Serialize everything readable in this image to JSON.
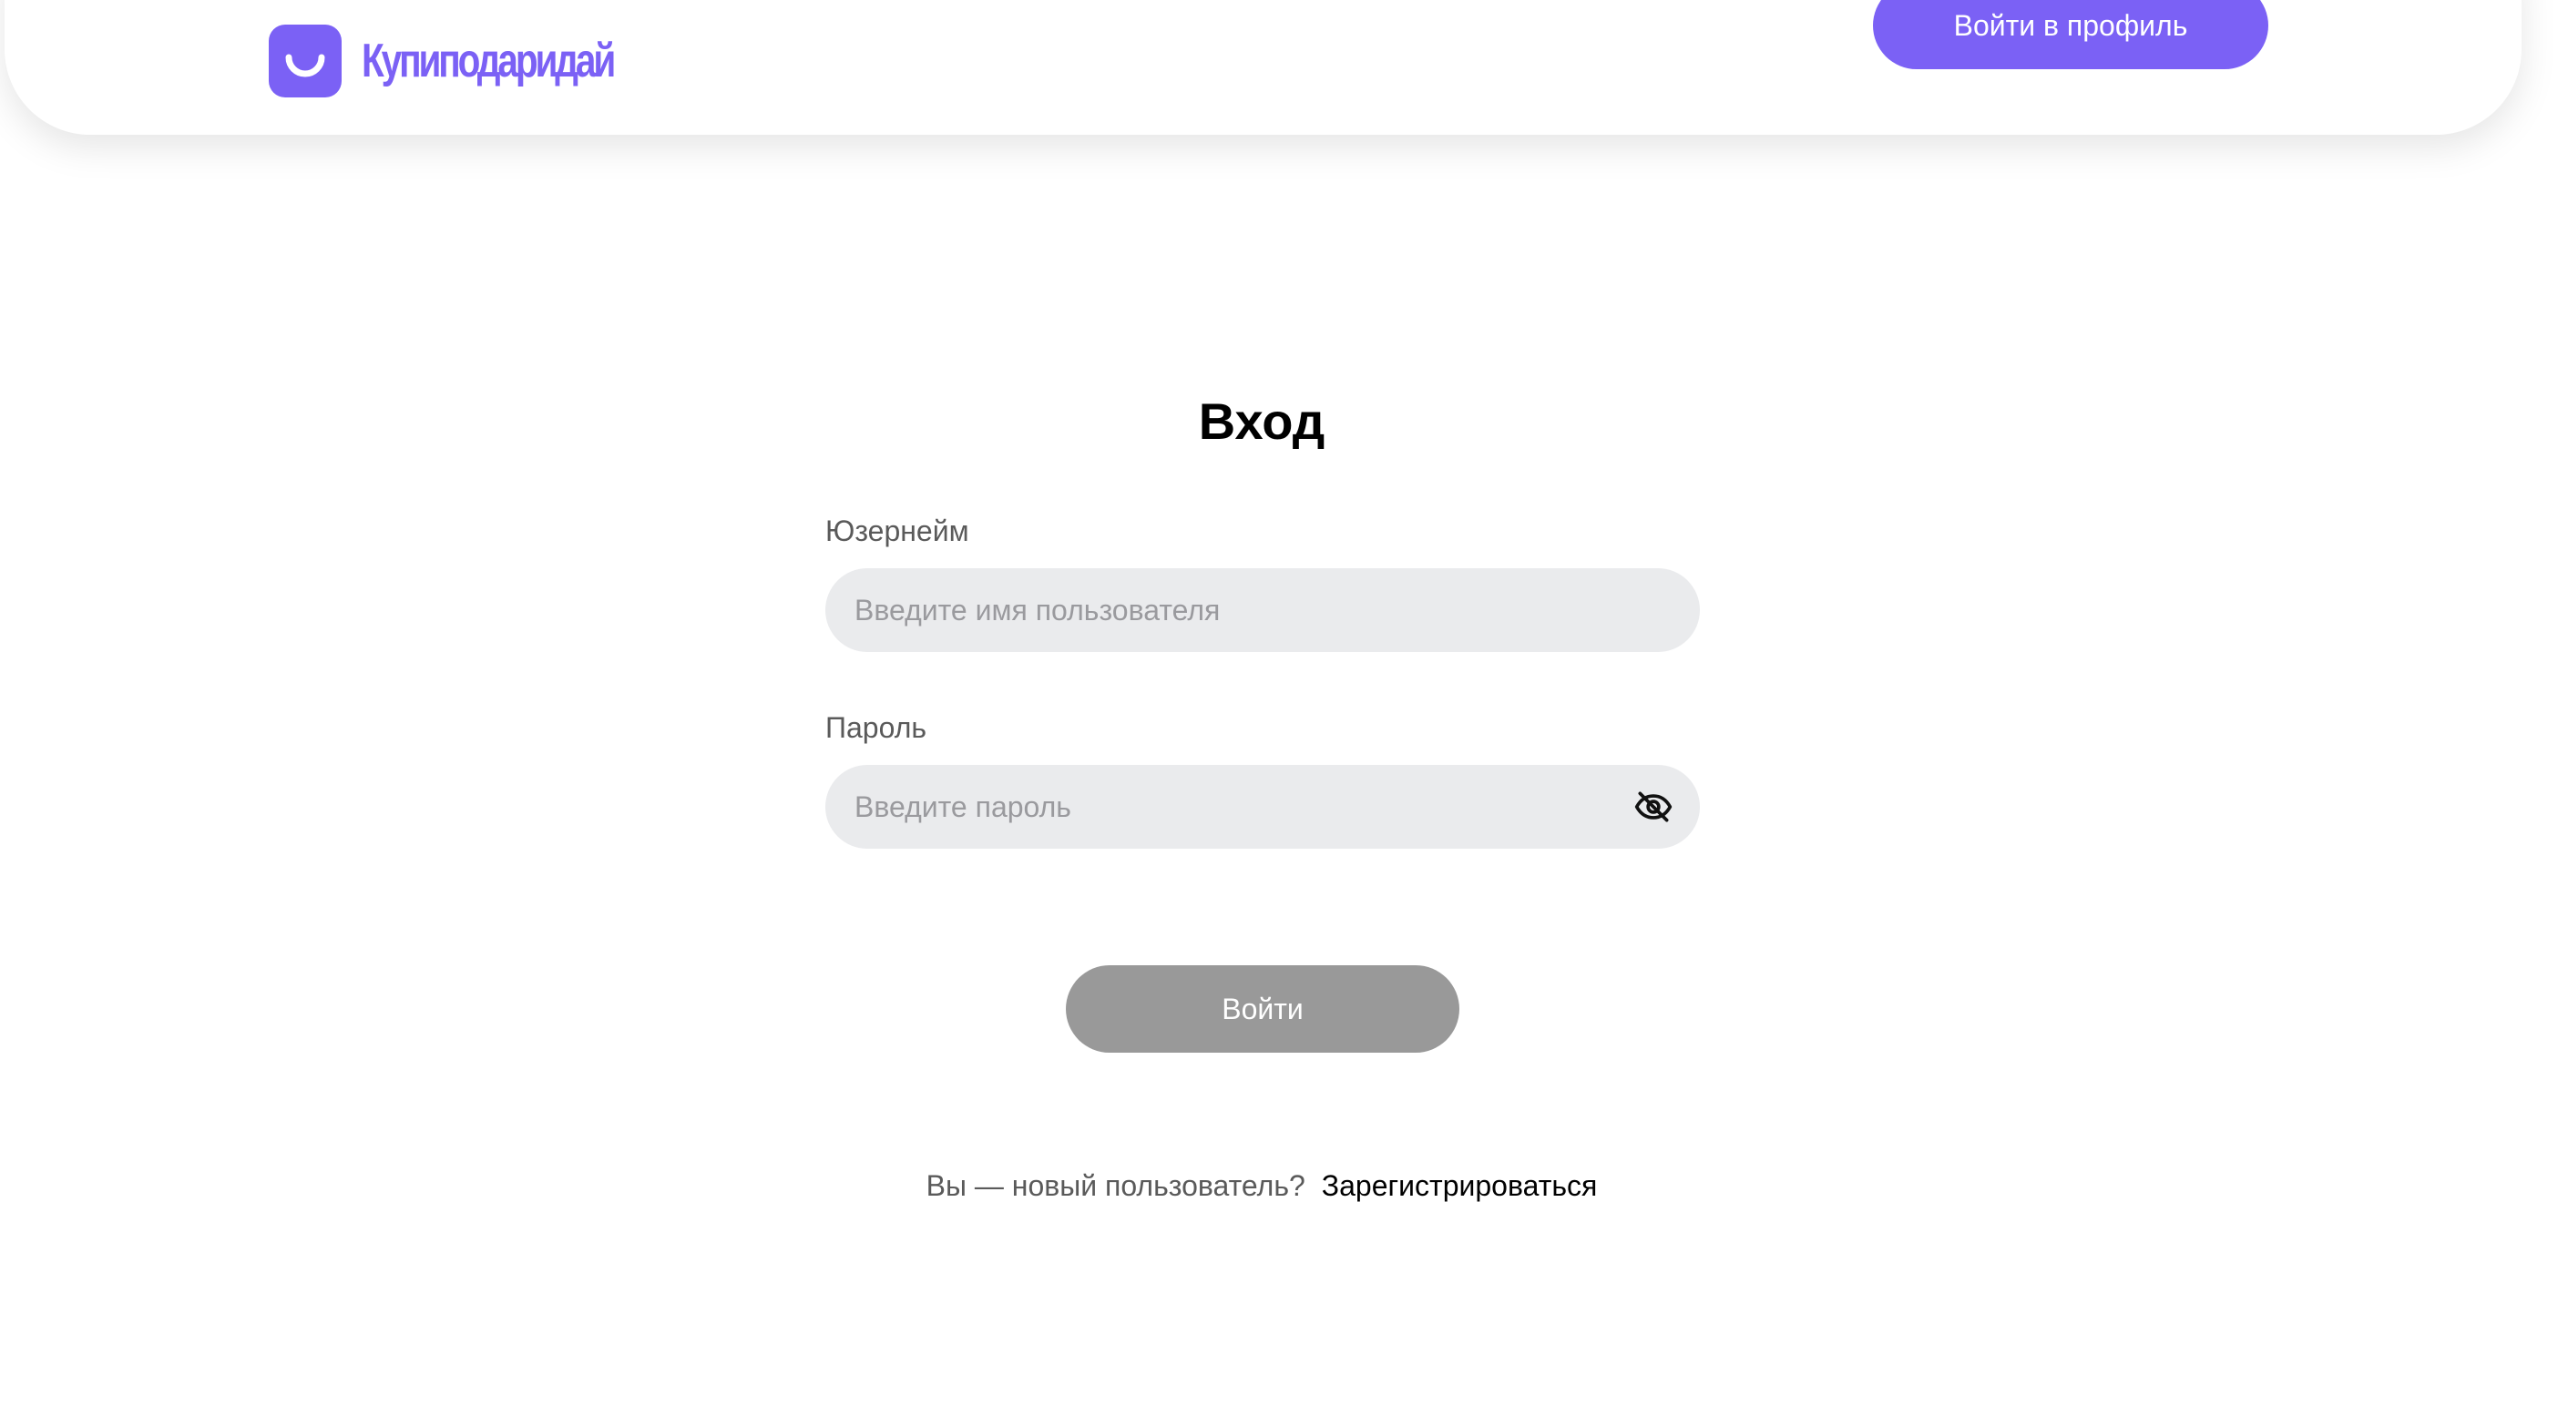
{
  "header": {
    "logo_text": "Купиподаридай",
    "login_button_label": "Войти в профиль"
  },
  "form": {
    "title": "Вход",
    "username": {
      "label": "Юзернейм",
      "placeholder": "Введите имя пользователя",
      "value": ""
    },
    "password": {
      "label": "Пароль",
      "placeholder": "Введите пароль",
      "value": "",
      "toggle_icon": "eye-off-icon"
    },
    "submit_label": "Войти",
    "register_prompt": "Вы — новый пользователь?",
    "register_link": "Зарегистрироваться"
  },
  "colors": {
    "accent": "#7b61f5",
    "input_background": "#eaebed",
    "submit_disabled": "#999999"
  }
}
